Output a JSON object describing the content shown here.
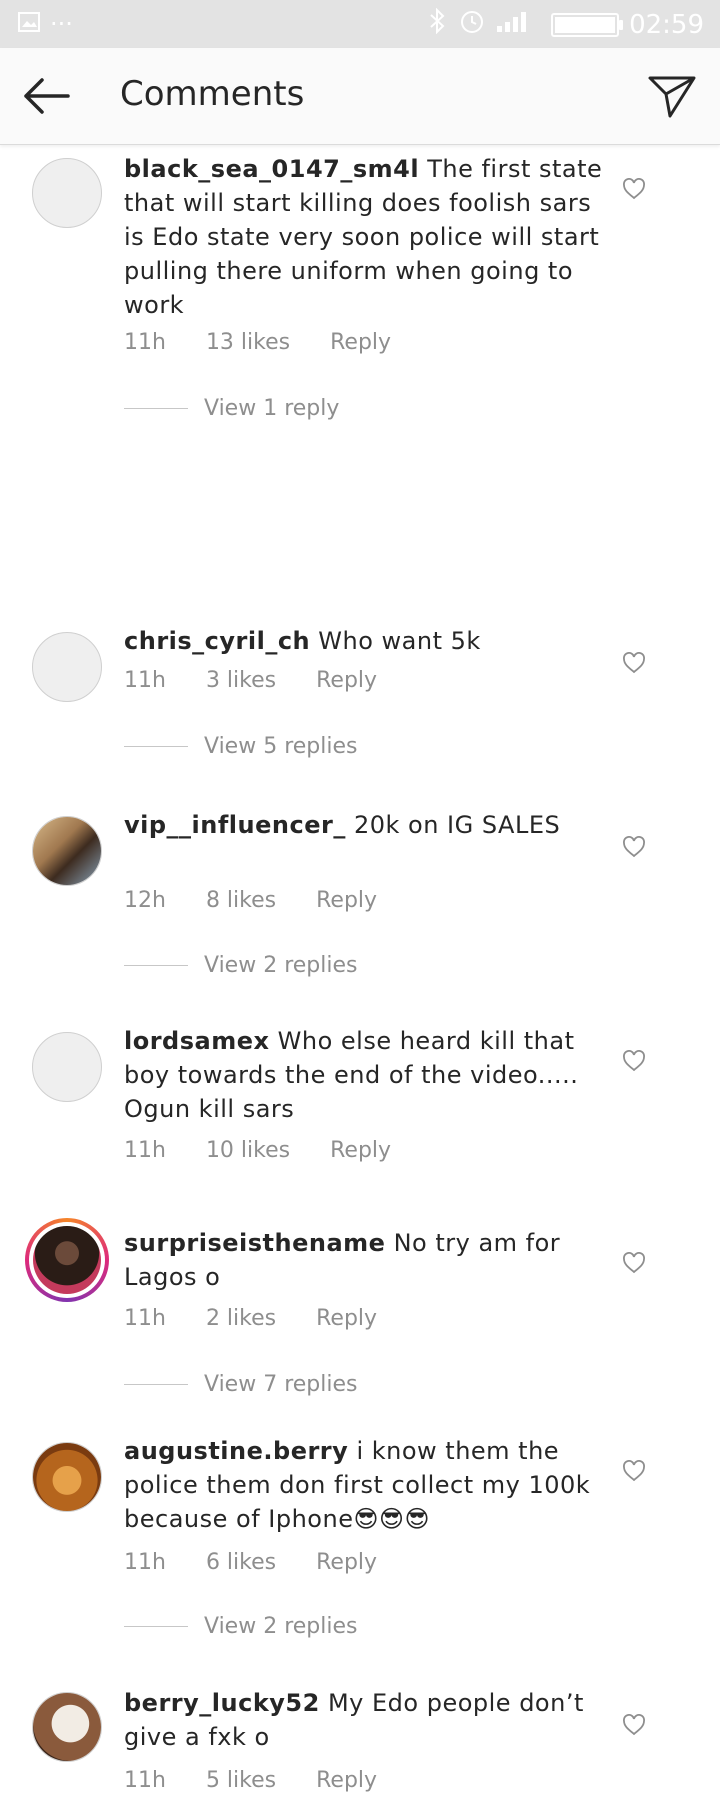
{
  "status_bar": {
    "time": "02:59",
    "left_icons": [
      "gallery-icon",
      "more-dots-icon"
    ],
    "right_icons": [
      "bluetooth-icon",
      "alarm-icon",
      "signal-icon",
      "battery-icon"
    ]
  },
  "header": {
    "title": "Comments"
  },
  "comments": [
    {
      "username": "black_sea_0147_sm4l",
      "text": "The first state that will start killing does foolish sars is Edo state very soon police will start pulling there uniform when going to work",
      "time": "11h",
      "likes": "13 likes",
      "reply": "Reply",
      "view_replies": "View 1 reply"
    },
    {
      "username": "chris_cyril_ch",
      "text": "Who want 5k",
      "time": "11h",
      "likes": "3 likes",
      "reply": "Reply",
      "view_replies": "View 5 replies"
    },
    {
      "username": "vip__influencer_",
      "text": "20k on IG SALES",
      "time": "12h",
      "likes": "8 likes",
      "reply": "Reply",
      "view_replies": "View 2 replies"
    },
    {
      "username": "lordsamex",
      "text": "Who else heard kill that boy towards the end of the video..... Ogun kill sars",
      "time": "11h",
      "likes": "10 likes",
      "reply": "Reply",
      "view_replies": ""
    },
    {
      "username": "surpriseisthename",
      "text": "No try am for Lagos o",
      "time": "11h",
      "likes": "2 likes",
      "reply": "Reply",
      "view_replies": "View 7 replies"
    },
    {
      "username": "augustine.berry",
      "text": "i know them the police them don first collect my 100k because of Iphone😎😎😎",
      "time": "11h",
      "likes": "6 likes",
      "reply": "Reply",
      "view_replies": "View 2 replies"
    },
    {
      "username": "berry_lucky52",
      "text": "My Edo people don’t give a fxk o",
      "time": "11h",
      "likes": "5 likes",
      "reply": "Reply",
      "view_replies": ""
    }
  ]
}
